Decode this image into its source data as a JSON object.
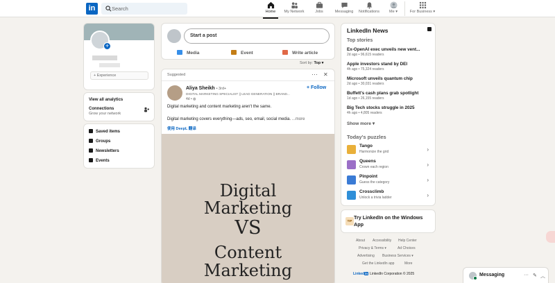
{
  "nav": {
    "logo": "in",
    "search_placeholder": "Search",
    "items": [
      {
        "label": "Home",
        "icon": "home-icon"
      },
      {
        "label": "My Network",
        "icon": "network-icon"
      },
      {
        "label": "Jobs",
        "icon": "jobs-icon"
      },
      {
        "label": "Messaging",
        "icon": "messaging-icon"
      },
      {
        "label": "Notifications",
        "icon": "bell-icon"
      },
      {
        "label": "Me ▾",
        "icon": "avatar"
      },
      {
        "label": "For Business ▾",
        "icon": "grid-icon"
      }
    ]
  },
  "profile": {
    "experience_label": "+  Experience",
    "analytics": "View all analytics",
    "connections_title": "Connections",
    "connections_sub": "Grow your network",
    "links": [
      "Saved items",
      "Groups",
      "Newsletters",
      "Events"
    ]
  },
  "composer": {
    "placeholder": "Start a post",
    "actions": [
      "Media",
      "Event",
      "Write article"
    ]
  },
  "sort": {
    "label": "Sort by:",
    "value": "Top ▾"
  },
  "post": {
    "suggested": "Suggested",
    "name": "Aliya Sheikh",
    "degree": "• 3rd+",
    "headline": "DIGITAL MARKETING SPECIALIST || LEAD GENERATION || BRAND...",
    "time": "4d • ",
    "follow": "+ Follow",
    "text1": "Digital marketing and content marketing aren't the same.",
    "text2": "Digital marketing covers everything—ads, seo, email, social media.",
    "more": "...more",
    "translate": "使用 DeepL 翻译",
    "image_lines": [
      "Digital",
      "Marketing",
      "VS",
      "Content",
      "Marketing"
    ]
  },
  "news": {
    "title": "LinkedIn News",
    "top_stories": "Top stories",
    "items": [
      {
        "headline": "Ex-OpenAI exec unveils new vent...",
        "meta": "2d ago • 96,615 readers"
      },
      {
        "headline": "Apple investors stand by DEI",
        "meta": "4h ago • 75,324 readers"
      },
      {
        "headline": "Microsoft unveils quantum chip",
        "meta": "2d ago • 30,031 readers"
      },
      {
        "headline": "Buffett's cash plans grab spotlight",
        "meta": "1d ago • 26,155 readers"
      },
      {
        "headline": "Big Tech stocks struggle in 2025",
        "meta": "4h ago • 4,805 readers"
      }
    ],
    "show_more": "Show more ▾",
    "puzzles_title": "Today's puzzles",
    "puzzles": [
      {
        "name": "Tango",
        "sub": "Harmonize the grid",
        "color": "#e9b03a"
      },
      {
        "name": "Queens",
        "sub": "Crown each region",
        "color": "#9b6fc7"
      },
      {
        "name": "Pinpoint",
        "sub": "Guess the category",
        "color": "#3a7bd5"
      },
      {
        "name": "Crossclimb",
        "sub": "Unlock a trivia ladder",
        "color": "#2f8fd8"
      }
    ]
  },
  "tip": {
    "badge": "TIP",
    "text": "Try LinkedIn on the Windows App"
  },
  "footer": {
    "row1": [
      "About",
      "Accessibility",
      "Help Center"
    ],
    "row2": [
      "Privacy & Terms ▾",
      "Ad Choices"
    ],
    "row3": [
      "Advertising",
      "Business Services ▾"
    ],
    "row4": [
      "Get the LinkedIn app",
      "More"
    ],
    "brand_word": "Linked",
    "brand_in": "in",
    "copyright": "LinkedIn Corporation © 2025"
  },
  "messaging": {
    "label": "Messaging",
    "more": "···",
    "compose": "✎",
    "collapse": "︿"
  },
  "colors": {
    "accent": "#0a66c2",
    "background": "#f4f2ee"
  }
}
